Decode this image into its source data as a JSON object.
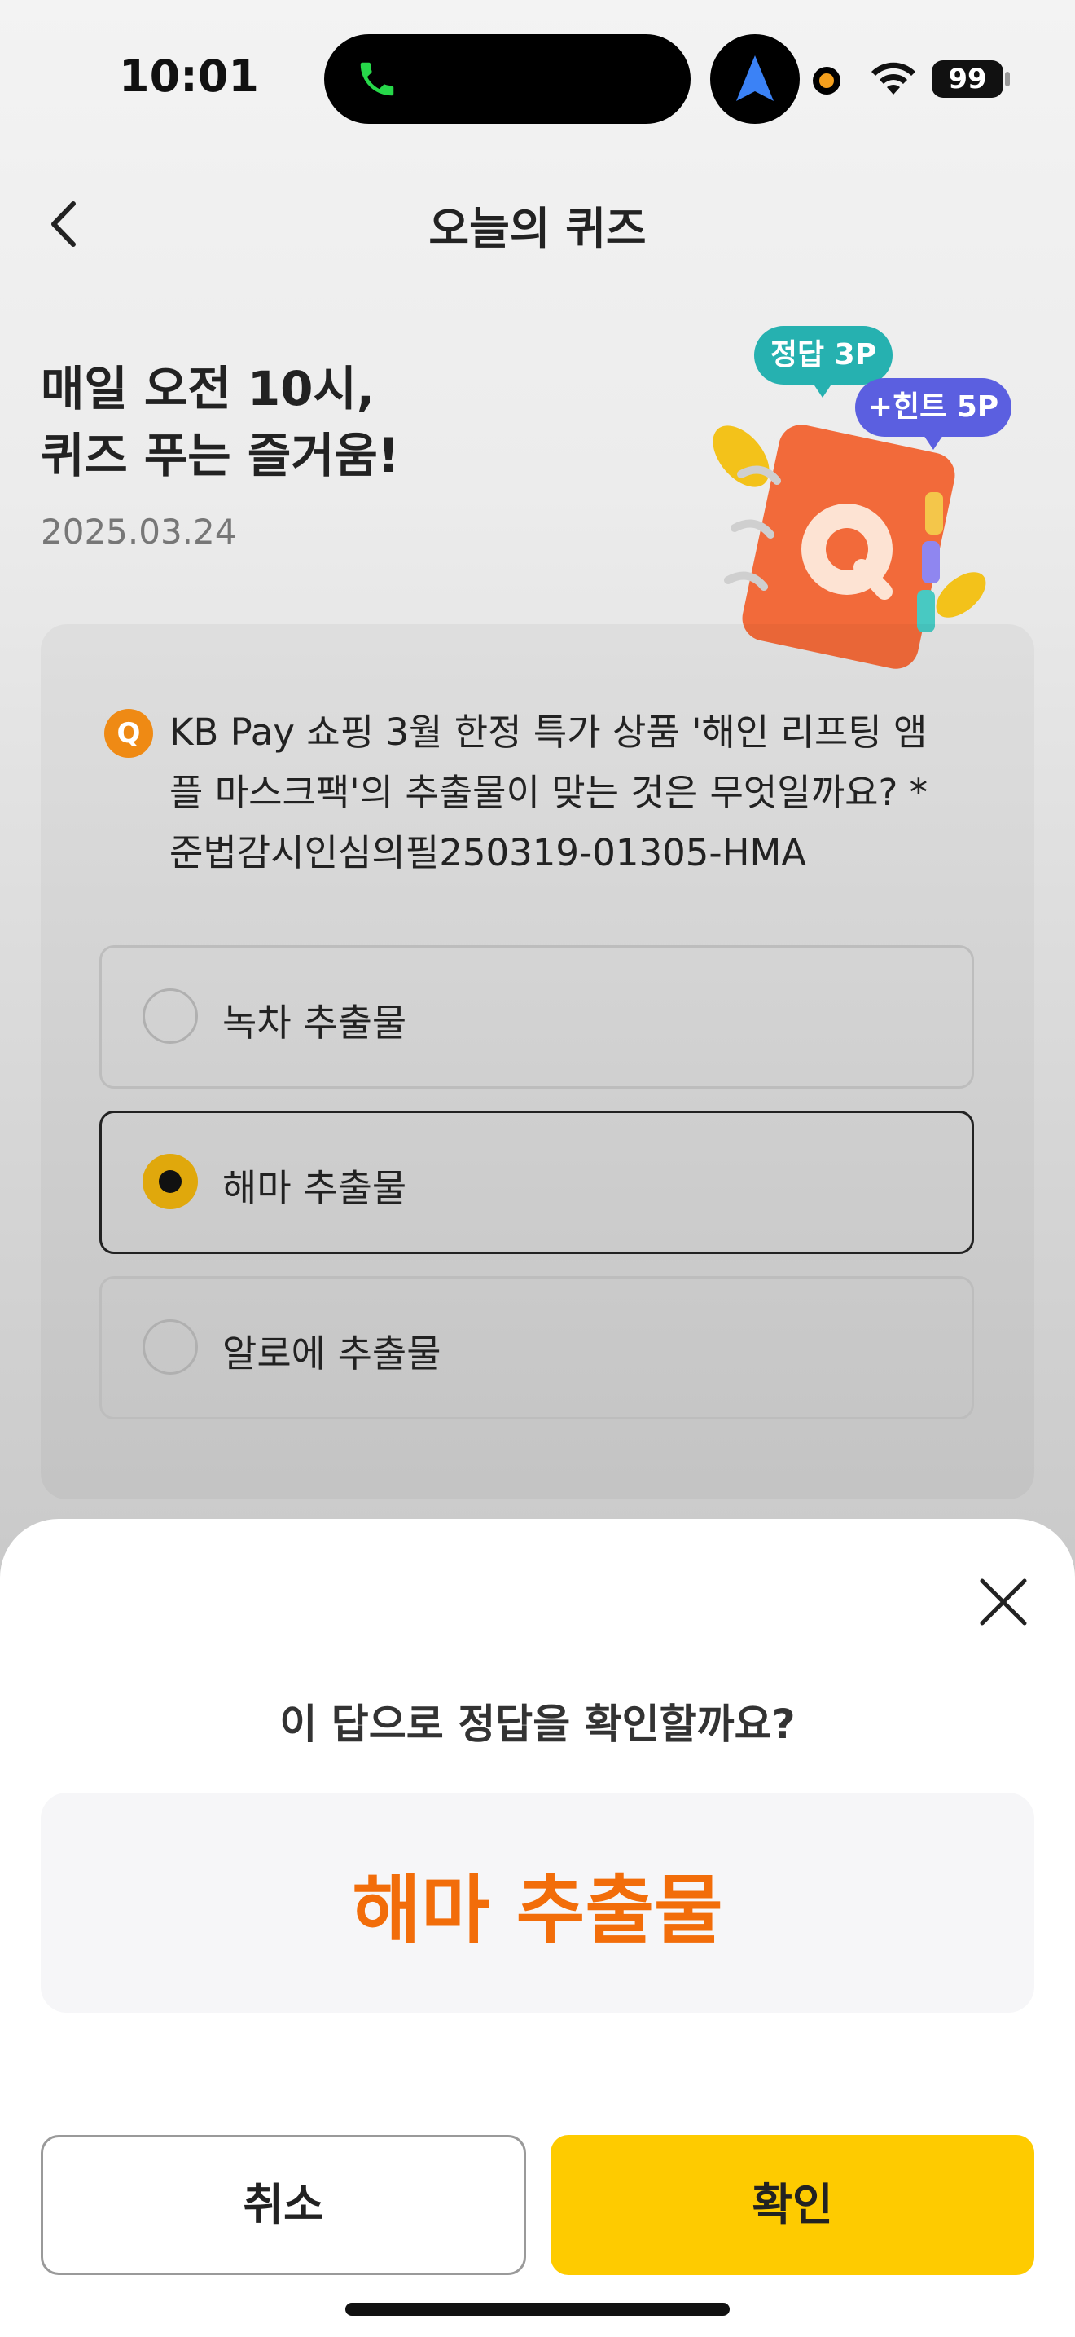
{
  "status_bar": {
    "time": "10:01",
    "battery": "99"
  },
  "header": {
    "title": "오늘의 퀴즈",
    "back_icon": "chevron-left-icon"
  },
  "hero": {
    "title_line1": "매일 오전 10시,",
    "title_line2": "퀴즈 푸는 즐거움!",
    "date": "2025.03.24",
    "badge_correct": "정답 3P",
    "badge_hint": "+힌트 5P"
  },
  "quiz": {
    "q_badge": "Q",
    "question_line1": "KB Pay 쇼핑 3월 한정 특가 상품 '해인 리프팅 앰",
    "question_line2": "플 마스크팩'의 추출물이 맞는 것은 무엇일까요? *",
    "question_line3": "준법감시인심의필250319-01305-HMA",
    "options": [
      {
        "label": "녹차 추출물",
        "selected": false
      },
      {
        "label": "해마 추출물",
        "selected": true
      },
      {
        "label": "알로에 추출물",
        "selected": false
      }
    ]
  },
  "sheet": {
    "question": "이 답으로 정답을 확인할까요?",
    "answer": "해마 추출물",
    "cancel_label": "취소",
    "confirm_label": "확인"
  },
  "colors": {
    "accent_orange": "#f26d0a",
    "confirm_yellow": "#fecb00",
    "teal": "#26b1b0",
    "purple": "#5b5fe0"
  }
}
